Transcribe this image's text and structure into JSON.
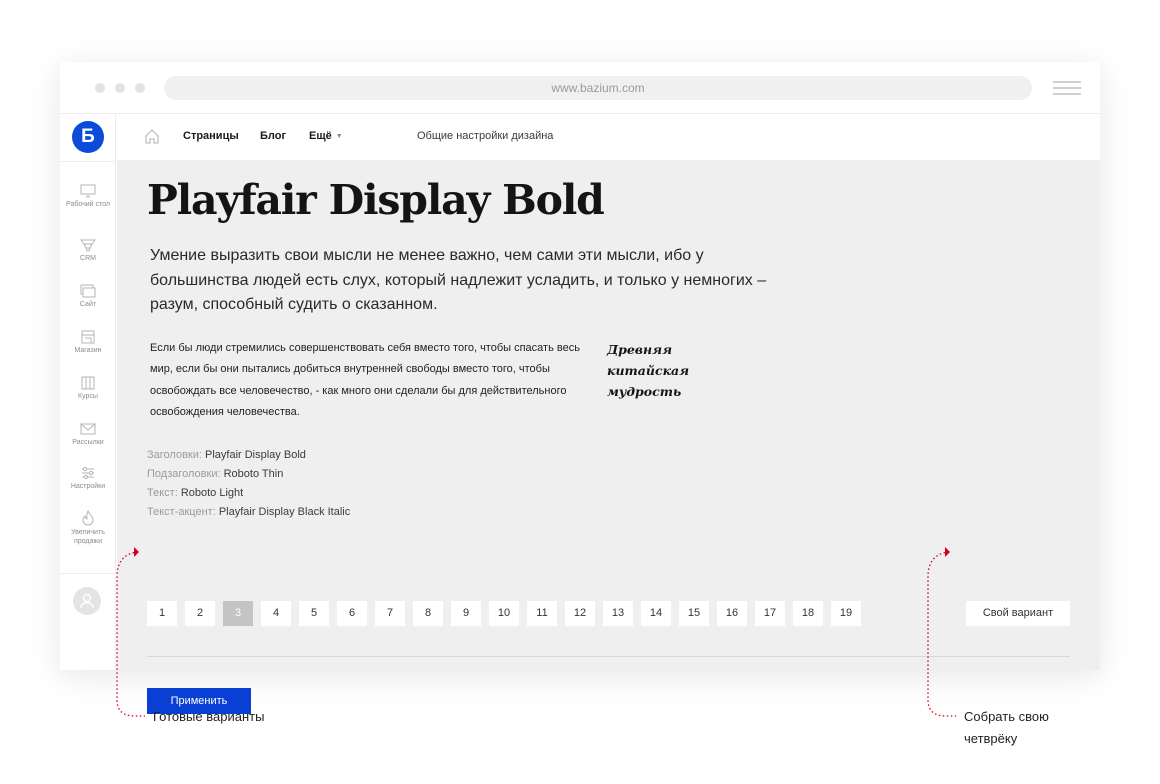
{
  "browser": {
    "url": "www.bazium.com"
  },
  "sidebar": {
    "logo": "Б",
    "items": [
      {
        "label": "Рабочий стол",
        "icon": "monitor-icon"
      },
      {
        "label": "CRM",
        "icon": "funnel-icon"
      },
      {
        "label": "Сайт",
        "icon": "browser-window-icon"
      },
      {
        "label": "Магазин",
        "icon": "shop-icon"
      },
      {
        "label": "Курсы",
        "icon": "book-icon"
      },
      {
        "label": "Рассылки",
        "icon": "mail-icon"
      },
      {
        "label": "Настройки",
        "icon": "sliders-icon"
      },
      {
        "label": "Увеличить продажи",
        "icon": "flame-icon"
      }
    ]
  },
  "topnav": {
    "pages": "Страницы",
    "blog": "Блог",
    "more": "Ещё",
    "design_settings": "Общие настройки дизайна"
  },
  "preview": {
    "heading": "Playfair Display Bold",
    "lead": "Умение выразить свои мысли не менее важно, чем сами эти мысли, ибо у большинства людей есть слух, который надлежит усладить, и только у немногих – разум, способный судить о сказанном.",
    "body": "Если бы люди стремились совершенствовать себя вместо того, чтобы спасать весь мир, если бы они пытались добиться внутренней свободы вместо того, чтобы освобождать все человечество, - как много они сделали бы для действительного освобождения человечества.",
    "accent": "Древняя китайская мудрость"
  },
  "font_info": [
    {
      "label": "Заголовки:",
      "value": "Playfair Display Bold"
    },
    {
      "label": "Подзаголовки:",
      "value": "Roboto Thin"
    },
    {
      "label": "Текст:",
      "value": "Roboto Light"
    },
    {
      "label": "Текст-акцент:",
      "value": "Playfair Display Black Italic"
    }
  ],
  "variants": {
    "pages": [
      "1",
      "2",
      "3",
      "4",
      "5",
      "6",
      "7",
      "8",
      "9",
      "10",
      "11",
      "12",
      "13",
      "14",
      "15",
      "16",
      "17",
      "18",
      "19"
    ],
    "selected": "3",
    "own_label": "Свой вариант"
  },
  "apply_label": "Применить",
  "annotations": {
    "ready": "Готовые варианты",
    "custom": "Собрать свою четврёку"
  },
  "colors": {
    "brand": "#0a4bdc",
    "apply": "#0a3fd4",
    "annotation": "#d0021b",
    "content_bg": "#efefef"
  }
}
